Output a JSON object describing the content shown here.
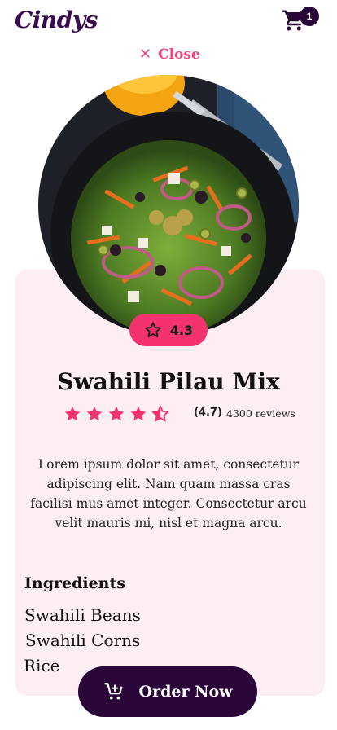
{
  "header": {
    "brand": "Cindys",
    "cart_count": "1"
  },
  "close_label": "Close",
  "product": {
    "rating_badge": "4.3",
    "name": "Swahili Pilau Mix",
    "stars_value": 4.5,
    "rating_text": "(4.7)",
    "reviews_text": "4300 reviews",
    "description": "Lorem ipsum dolor sit amet, consectetur adipiscing elit. Nam quam massa cras facilisi mus amet integer. Consectetur arcu velit mauris mi, nisl et magna arcu.",
    "ingredients_title": "Ingredients",
    "ingredients": [
      "Swahili Beans",
      "Swahili Corns",
      "Rice"
    ]
  },
  "order_label": "Order Now",
  "colors": {
    "accent": "#f4336e",
    "brand_dark": "#2a0639",
    "card_bg": "#fdeef3"
  },
  "icons": [
    "cart-icon",
    "close-icon",
    "star-outline-icon",
    "star-icon",
    "half-star-icon",
    "cart-add-icon"
  ]
}
